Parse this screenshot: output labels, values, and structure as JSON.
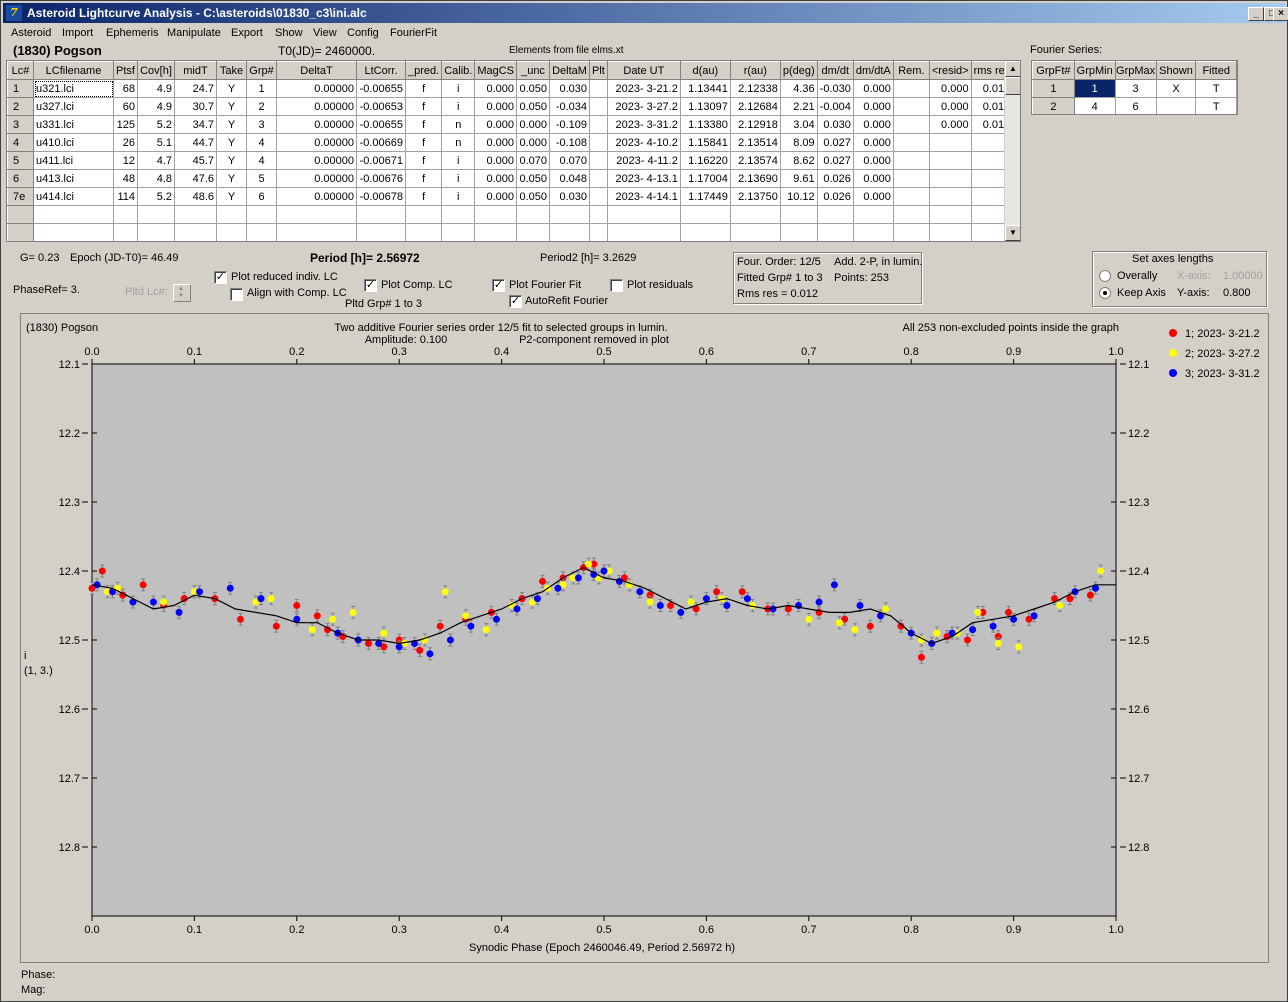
{
  "window": {
    "title": "Asteroid Lightcurve Analysis - C:\\asteroids\\01830_c3\\ini.alc",
    "icon": "app-logo-icon",
    "buttons": {
      "minimize": "_",
      "maximize": "□",
      "close": "×"
    }
  },
  "menu": [
    "Asteroid",
    "Import",
    "Ephemeris",
    "Manipulate",
    "Export",
    "Show",
    "View",
    "Config",
    "FourierFit"
  ],
  "header": {
    "asteroid": "(1830) Pogson",
    "t0": "T0(JD)= 2460000.",
    "elements": "Elements from file elms.xt",
    "fourier_label": "Fourier Series:"
  },
  "lc_table": {
    "columns": [
      "Lc#",
      "LCfilename",
      "Ptsf",
      "Cov[h]",
      "midT",
      "Take",
      "Grp#",
      "DeltaT",
      "LtCorr.",
      "_pred.",
      "Calib.",
      "MagCS",
      "_unc",
      "DeltaM",
      "Plt",
      "Date UT",
      "d(au)",
      "r(au)",
      "p(deg)",
      "dm/dt",
      "dm/dtA",
      "Rem.",
      "<resid>",
      "rms res"
    ],
    "rows": [
      [
        "1",
        "u321.lci",
        "68",
        "4.9",
        "24.7",
        "Y",
        "1",
        "0.00000",
        "-0.00655",
        "f",
        "i",
        "0.000",
        "0.050",
        "0.030",
        "",
        "2023- 3-21.2",
        "1.13441",
        "2.12338",
        "4.36",
        "-0.030",
        "0.000",
        "",
        "0.000",
        "0.012"
      ],
      [
        "2",
        "u327.lci",
        "60",
        "4.9",
        "30.7",
        "Y",
        "2",
        "0.00000",
        "-0.00653",
        "f",
        "i",
        "0.000",
        "0.050",
        "-0.034",
        "",
        "2023- 3-27.2",
        "1.13097",
        "2.12684",
        "2.21",
        "-0.004",
        "0.000",
        "",
        "0.000",
        "0.012"
      ],
      [
        "3",
        "u331.lci",
        "125",
        "5.2",
        "34.7",
        "Y",
        "3",
        "0.00000",
        "-0.00655",
        "f",
        "n",
        "0.000",
        "0.000",
        "-0.109",
        "",
        "2023- 3-31.2",
        "1.13380",
        "2.12918",
        "3.04",
        "0.030",
        "0.000",
        "",
        "0.000",
        "0.010"
      ],
      [
        "4",
        "u410.lci",
        "26",
        "5.1",
        "44.7",
        "Y",
        "4",
        "0.00000",
        "-0.00669",
        "f",
        "n",
        "0.000",
        "0.000",
        "-0.108",
        "",
        "2023- 4-10.2",
        "1.15841",
        "2.13514",
        "8.09",
        "0.027",
        "0.000",
        "",
        "",
        ""
      ],
      [
        "5",
        "u411.lci",
        "12",
        "4.7",
        "45.7",
        "Y",
        "4",
        "0.00000",
        "-0.00671",
        "f",
        "i",
        "0.000",
        "0.070",
        "0.070",
        "",
        "2023- 4-11.2",
        "1.16220",
        "2.13574",
        "8.62",
        "0.027",
        "0.000",
        "",
        "",
        ""
      ],
      [
        "6",
        "u413.lci",
        "48",
        "4.8",
        "47.6",
        "Y",
        "5",
        "0.00000",
        "-0.00676",
        "f",
        "i",
        "0.000",
        "0.050",
        "0.048",
        "",
        "2023- 4-13.1",
        "1.17004",
        "2.13690",
        "9.61",
        "0.026",
        "0.000",
        "",
        "",
        ""
      ],
      [
        "7e",
        "u414.lci",
        "114",
        "5.2",
        "48.6",
        "Y",
        "6",
        "0.00000",
        "-0.00678",
        "f",
        "i",
        "0.000",
        "0.050",
        "0.030",
        "",
        "2023- 4-14.1",
        "1.17449",
        "2.13750",
        "10.12",
        "0.026",
        "0.000",
        "",
        "",
        ""
      ]
    ]
  },
  "fourier_table": {
    "columns": [
      "GrpFt#",
      "GrpMin",
      "GrpMax",
      "Shown",
      "Fitted"
    ],
    "rows": [
      [
        "1",
        "1",
        "3",
        "X",
        "T"
      ],
      [
        "2",
        "4",
        "6",
        "",
        "T"
      ]
    ]
  },
  "params": {
    "g": "G= 0.23",
    "epoch": "Epoch (JD-T0)= 46.49",
    "period_label": "Period [h]= ",
    "period_value": "2.56972",
    "period2": "Period2 [h]= 3.2629",
    "phase_ref": "PhaseRef= 3.",
    "pltd_lc_label": "Pltd Lc#:",
    "pltd_grp": "Pltd Grp#  1   to   3"
  },
  "checkboxes": {
    "plot_reduced": {
      "label": "Plot reduced indiv. LC",
      "checked": true
    },
    "align_comp": {
      "label": "Align with Comp. LC",
      "checked": false
    },
    "plot_comp": {
      "label": "Plot Comp. LC",
      "checked": true
    },
    "plot_fourier": {
      "label": "Plot Fourier Fit",
      "checked": true
    },
    "autorefit": {
      "label": "AutoRefit Fourier",
      "checked": true
    },
    "plot_residuals": {
      "label": "Plot residuals",
      "checked": false
    }
  },
  "fourier_info": {
    "order": "Four. Order: 12/5",
    "add": "Add. 2-P, in lumin.",
    "fitted": "Fitted Grp# 1 to 3",
    "points": "Points: 253",
    "rms": "Rms res      = 0.012"
  },
  "axes_box": {
    "title": "Set axes lengths",
    "overally": "Overally",
    "keep_axis": "Keep Axis",
    "x_axis_label": "X-axis:",
    "x_axis_value": "1.00000",
    "y_axis_label": "Y-axis:",
    "y_axis_value": "0.800",
    "selected": "keep_axis"
  },
  "plot": {
    "name": "(1830) Pogson",
    "caption1": "Two additive Fourier series order 12/5 fit to selected groups in lumin.",
    "caption2": "Amplitude: 0.100",
    "caption3": "P2-component removed in plot",
    "points_note": "All 253 non-excluded points inside the graph",
    "y_label": "i",
    "y_label2": "(1, 3.)",
    "x_label": "Synodic Phase (Epoch 2460046.49, Period 2.56972 h)"
  },
  "chart_data": {
    "type": "scatter",
    "title": "Two additive Fourier series order 12/5 fit to selected groups in lumin.",
    "xlabel": "Synodic Phase (Epoch 2460046.49, Period 2.56972 h)",
    "ylabel": "i",
    "xlim": [
      0.0,
      1.0
    ],
    "ylim": [
      12.1,
      12.9
    ],
    "y_inverted": true,
    "x_ticks": [
      "0.0",
      "0.1",
      "0.2",
      "0.3",
      "0.4",
      "0.5",
      "0.6",
      "0.7",
      "0.8",
      "0.9",
      "1.0"
    ],
    "y_ticks": [
      "12.1",
      "12.2",
      "12.3",
      "12.4",
      "12.5",
      "12.6",
      "12.7",
      "12.8"
    ],
    "legend_position": "right",
    "fit_curve": {
      "x": [
        0.0,
        0.02,
        0.04,
        0.06,
        0.08,
        0.1,
        0.12,
        0.14,
        0.16,
        0.18,
        0.2,
        0.22,
        0.24,
        0.26,
        0.28,
        0.3,
        0.32,
        0.34,
        0.36,
        0.38,
        0.4,
        0.42,
        0.44,
        0.46,
        0.48,
        0.5,
        0.52,
        0.54,
        0.56,
        0.58,
        0.6,
        0.62,
        0.64,
        0.66,
        0.68,
        0.7,
        0.72,
        0.74,
        0.76,
        0.78,
        0.8,
        0.82,
        0.84,
        0.86,
        0.88,
        0.9,
        0.92,
        0.94,
        0.96,
        0.98,
        1.0
      ],
      "y": [
        12.42,
        12.425,
        12.44,
        12.455,
        12.45,
        12.435,
        12.44,
        12.455,
        12.46,
        12.465,
        12.475,
        12.475,
        12.49,
        12.5,
        12.5,
        12.505,
        12.5,
        12.49,
        12.475,
        12.465,
        12.455,
        12.44,
        12.43,
        12.41,
        12.395,
        12.41,
        12.415,
        12.425,
        12.44,
        12.455,
        12.445,
        12.44,
        12.45,
        12.455,
        12.45,
        12.455,
        12.46,
        12.46,
        12.455,
        12.465,
        12.49,
        12.505,
        12.495,
        12.475,
        12.47,
        12.465,
        12.455,
        12.445,
        12.43,
        12.42,
        12.42
      ]
    },
    "series": [
      {
        "name": "1; 2023- 3-21.2",
        "color": "#ff0000",
        "x": [
          0.0,
          0.01,
          0.03,
          0.05,
          0.07,
          0.09,
          0.12,
          0.145,
          0.18,
          0.2,
          0.22,
          0.23,
          0.245,
          0.27,
          0.285,
          0.3,
          0.32,
          0.34,
          0.365,
          0.39,
          0.42,
          0.44,
          0.46,
          0.48,
          0.49,
          0.52,
          0.545,
          0.565,
          0.59,
          0.61,
          0.635,
          0.66,
          0.68,
          0.71,
          0.735,
          0.76,
          0.79,
          0.81,
          0.835,
          0.855,
          0.87,
          0.885,
          0.895,
          0.915,
          0.94,
          0.955,
          0.975
        ],
        "y": [
          12.425,
          12.4,
          12.435,
          12.42,
          12.45,
          12.44,
          12.44,
          12.47,
          12.48,
          12.45,
          12.465,
          12.485,
          12.495,
          12.505,
          12.51,
          12.5,
          12.515,
          12.48,
          12.47,
          12.46,
          12.44,
          12.415,
          12.41,
          12.395,
          12.39,
          12.41,
          12.435,
          12.45,
          12.455,
          12.43,
          12.43,
          12.455,
          12.455,
          12.46,
          12.47,
          12.48,
          12.48,
          12.525,
          12.495,
          12.5,
          12.46,
          12.495,
          12.46,
          12.47,
          12.44,
          12.44,
          12.435
        ]
      },
      {
        "name": "2; 2023- 3-27.2",
        "color": "#ffff00",
        "x": [
          0.015,
          0.025,
          0.07,
          0.1,
          0.16,
          0.175,
          0.215,
          0.235,
          0.255,
          0.285,
          0.305,
          0.325,
          0.345,
          0.365,
          0.385,
          0.41,
          0.43,
          0.445,
          0.46,
          0.47,
          0.485,
          0.495,
          0.505,
          0.525,
          0.545,
          0.585,
          0.615,
          0.645,
          0.7,
          0.73,
          0.745,
          0.775,
          0.81,
          0.825,
          0.845,
          0.865,
          0.885,
          0.905,
          0.945,
          0.985
        ],
        "y": [
          12.43,
          12.425,
          12.445,
          12.43,
          12.445,
          12.44,
          12.485,
          12.47,
          12.46,
          12.49,
          12.505,
          12.5,
          12.43,
          12.465,
          12.485,
          12.45,
          12.445,
          12.425,
          12.42,
          12.41,
          12.39,
          12.41,
          12.4,
          12.42,
          12.445,
          12.445,
          12.44,
          12.45,
          12.47,
          12.475,
          12.485,
          12.455,
          12.5,
          12.49,
          12.49,
          12.46,
          12.505,
          12.51,
          12.45,
          12.4
        ]
      },
      {
        "name": "3; 2023- 3-31.2",
        "color": "#0000ff",
        "x": [
          0.005,
          0.02,
          0.04,
          0.06,
          0.085,
          0.105,
          0.135,
          0.165,
          0.2,
          0.24,
          0.26,
          0.28,
          0.3,
          0.315,
          0.33,
          0.35,
          0.37,
          0.395,
          0.415,
          0.435,
          0.455,
          0.475,
          0.49,
          0.5,
          0.515,
          0.535,
          0.555,
          0.575,
          0.6,
          0.62,
          0.64,
          0.665,
          0.69,
          0.71,
          0.725,
          0.75,
          0.77,
          0.8,
          0.82,
          0.84,
          0.86,
          0.88,
          0.9,
          0.92,
          0.96,
          0.98
        ],
        "y": [
          12.42,
          12.43,
          12.445,
          12.445,
          12.46,
          12.43,
          12.425,
          12.44,
          12.47,
          12.49,
          12.5,
          12.505,
          12.51,
          12.505,
          12.52,
          12.5,
          12.48,
          12.47,
          12.455,
          12.44,
          12.425,
          12.41,
          12.405,
          12.4,
          12.415,
          12.43,
          12.45,
          12.46,
          12.44,
          12.45,
          12.44,
          12.455,
          12.45,
          12.445,
          12.42,
          12.45,
          12.465,
          12.49,
          12.505,
          12.49,
          12.485,
          12.48,
          12.47,
          12.465,
          12.43,
          12.425
        ]
      }
    ]
  },
  "status": {
    "phase": "Phase:",
    "mag": "Mag:"
  }
}
